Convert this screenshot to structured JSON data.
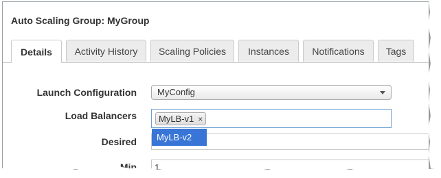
{
  "title": "Auto Scaling Group: MyGroup",
  "tabs": [
    {
      "label": "Details",
      "active": true
    },
    {
      "label": "Activity History",
      "active": false
    },
    {
      "label": "Scaling Policies",
      "active": false
    },
    {
      "label": "Instances",
      "active": false
    },
    {
      "label": "Notifications",
      "active": false
    },
    {
      "label": "Tags",
      "active": false
    }
  ],
  "form": {
    "launch_configuration": {
      "label": "Launch Configuration",
      "value": "MyConfig"
    },
    "load_balancers": {
      "label": "Load Balancers",
      "selected": [
        "MyLB-v1"
      ],
      "remove_symbol": "×",
      "dropdown_option": "MyLB-v2"
    },
    "desired": {
      "label": "Desired",
      "value": ""
    },
    "min": {
      "label": "Min",
      "value": "1"
    }
  },
  "colors": {
    "selection_highlight": "#3875d7",
    "focus_border": "#6d9fd2"
  }
}
